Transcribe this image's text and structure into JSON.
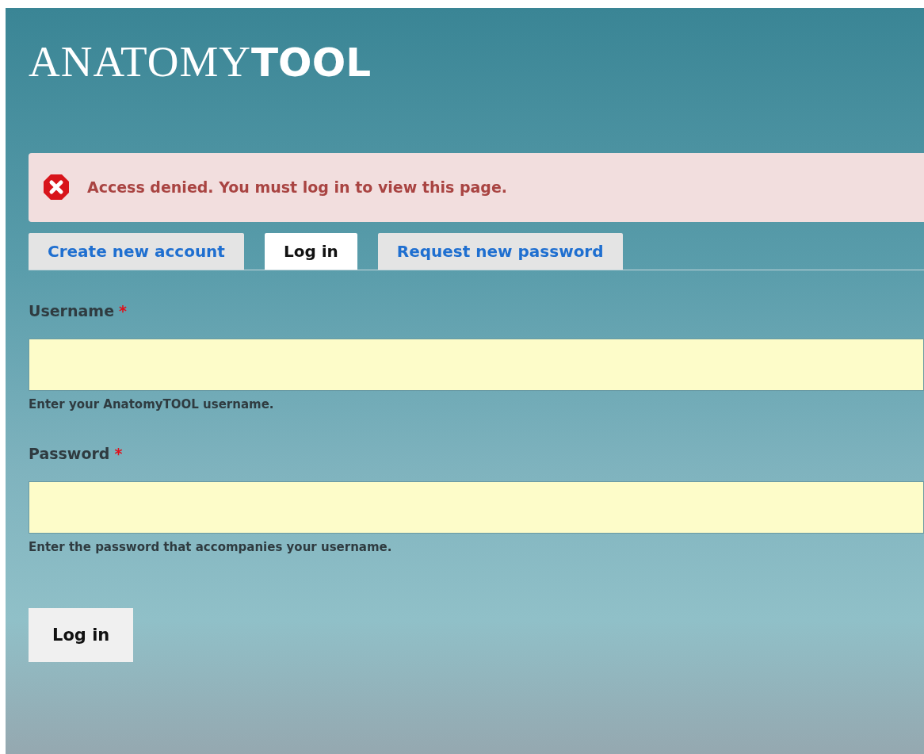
{
  "logo": "ANATOMY**TOOL**",
  "message": {
    "kind": "error",
    "text": "Access denied. You must log in to view this page."
  },
  "tabs": [
    {
      "label": "Create new account",
      "selected": false
    },
    {
      "label": "Log in",
      "selected": true
    },
    {
      "label": "Request new password",
      "selected": false
    }
  ],
  "fields": [
    {
      "label": "Username",
      "required_mark": "*",
      "help": "Enter your AnatomyTOOL username."
    },
    {
      "label": "Password",
      "required_mark": "*",
      "help": "Enter the password that accompanies your username."
    }
  ],
  "submit": "Log in"
}
